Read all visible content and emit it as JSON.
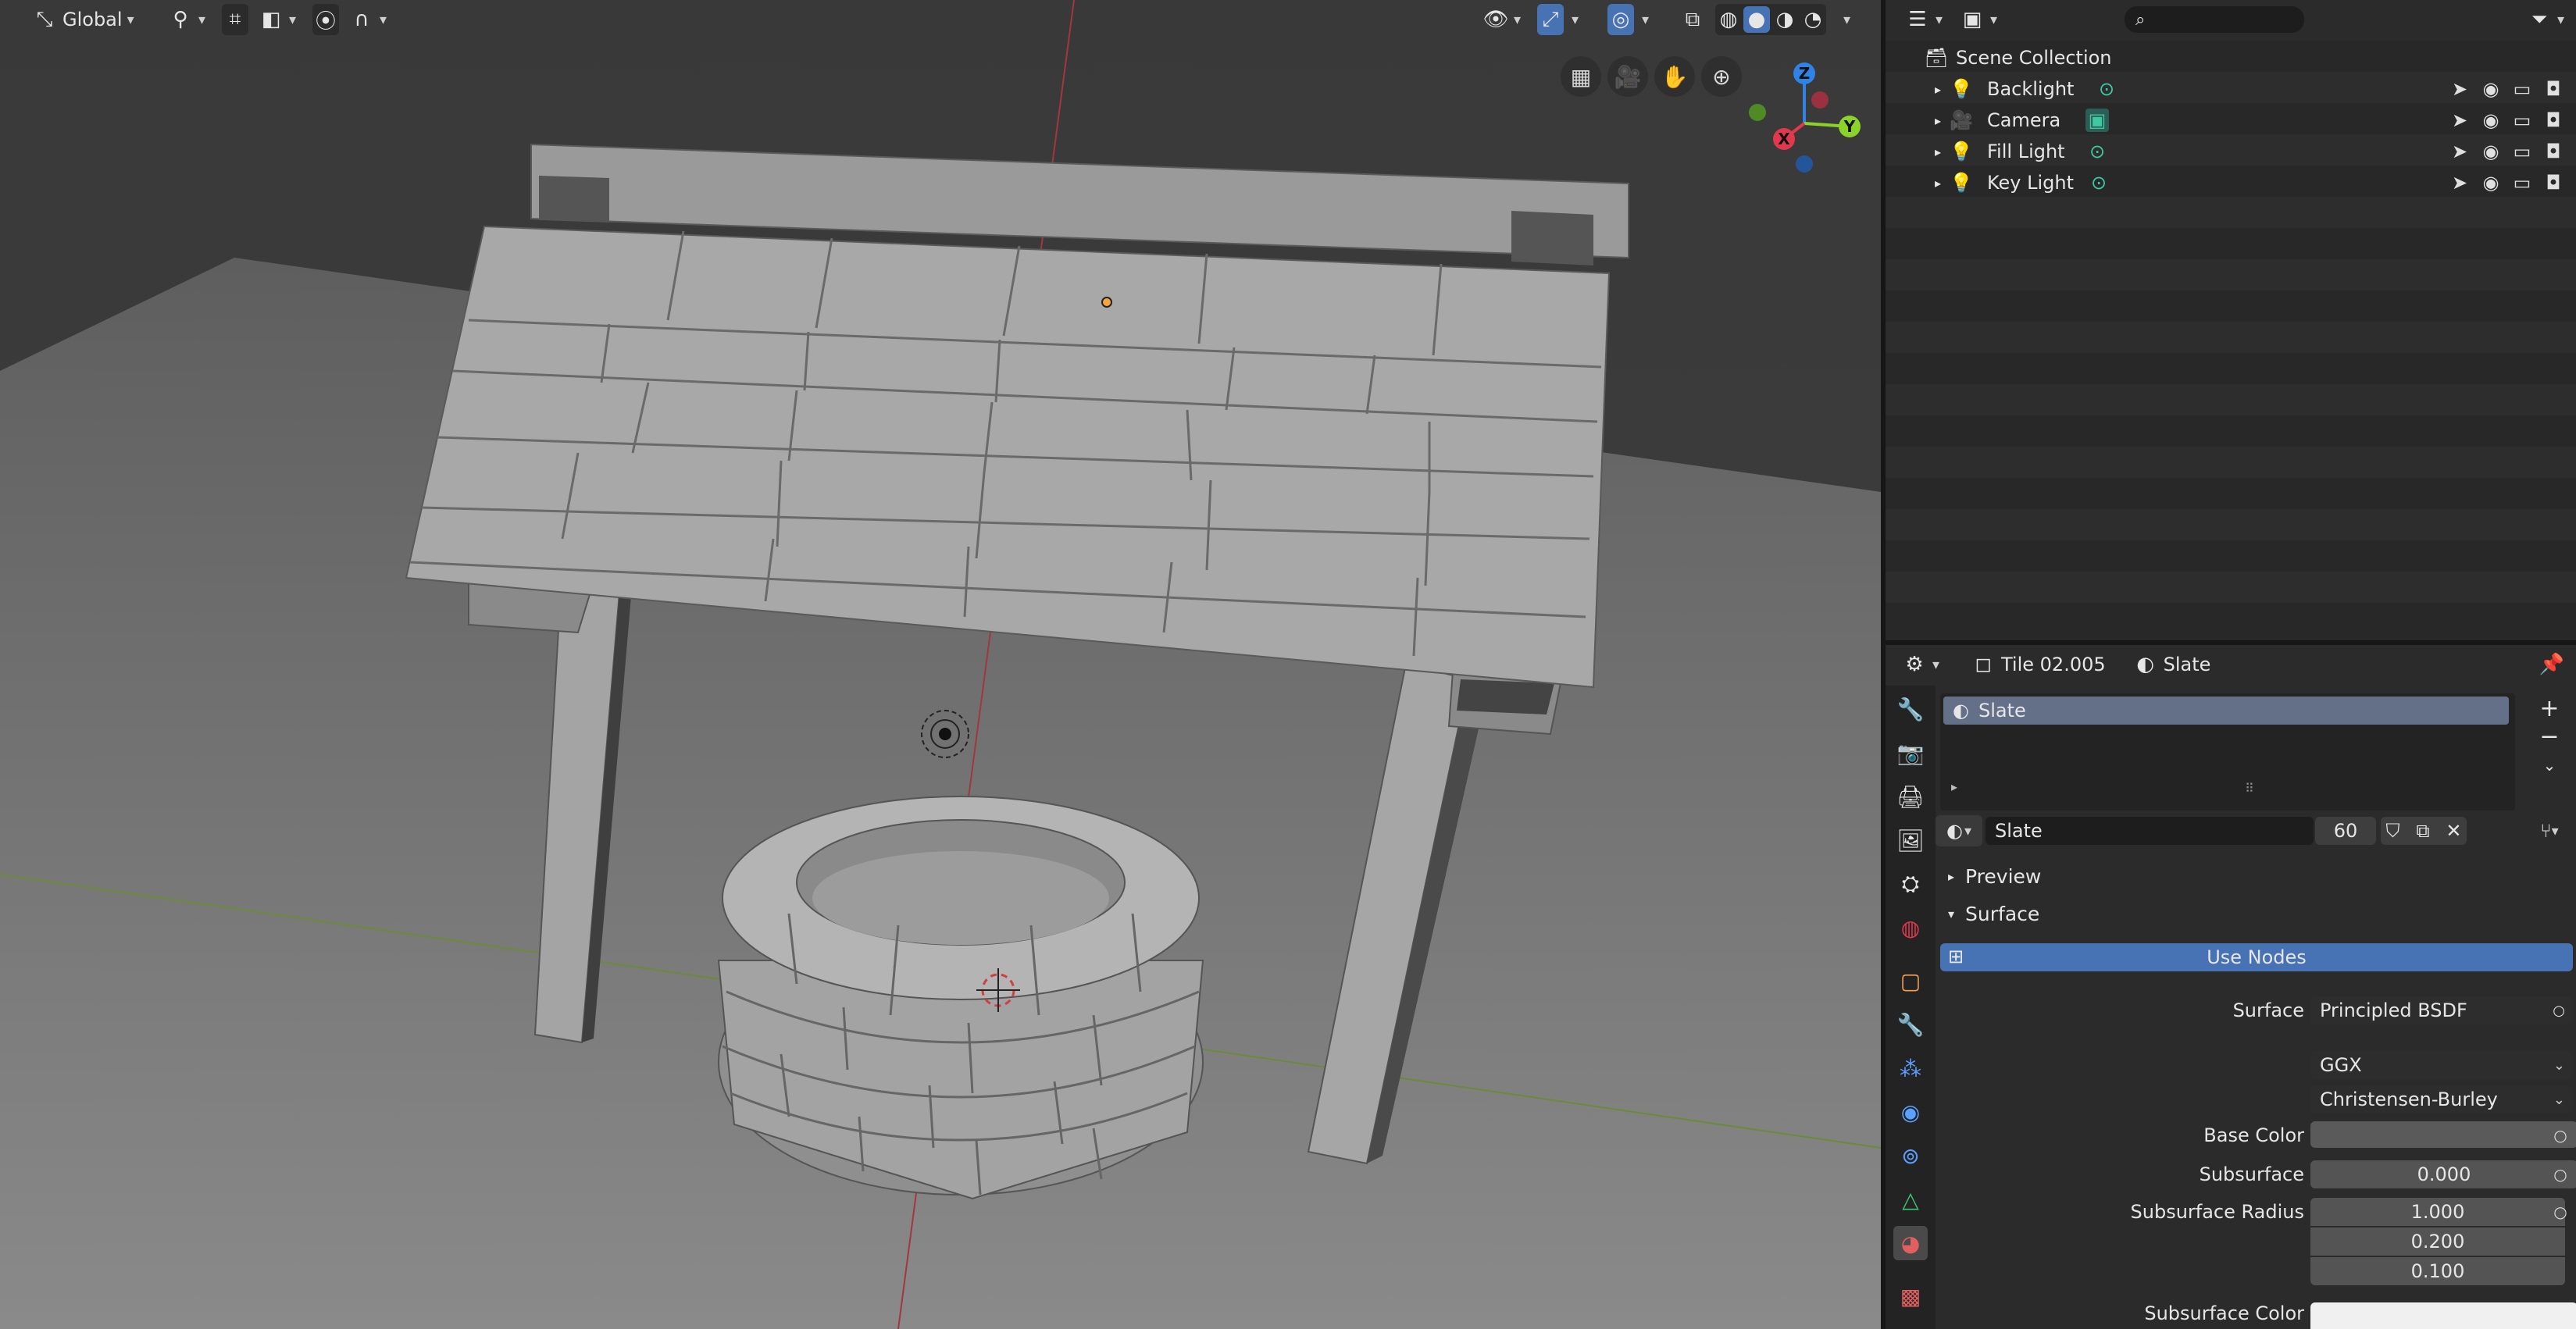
{
  "viewport": {
    "transform_orientation": "Global",
    "gizmo_axes": {
      "x": "X",
      "y": "Y",
      "z": "Z"
    }
  },
  "outliner": {
    "root": "Scene Collection",
    "items": [
      {
        "label": "Backlight"
      },
      {
        "label": "Camera"
      },
      {
        "label": "Fill Light"
      },
      {
        "label": "Key Light"
      }
    ]
  },
  "properties": {
    "object_name": "Tile 02.005",
    "material_name": "Slate",
    "slots": [
      {
        "label": "Slate"
      }
    ],
    "material_field": "Slate",
    "user_count": "60",
    "panels": {
      "preview": "Preview",
      "surface": "Surface"
    },
    "use_nodes_label": "Use Nodes",
    "fields": {
      "surface_label": "Surface",
      "surface_value": "Principled BSDF",
      "distribution": "GGX",
      "subsurface_method": "Christensen-Burley",
      "base_color_label": "Base Color",
      "subsurface_label": "Subsurface",
      "subsurface_value": "0.000",
      "subsurface_radius_label": "Subsurface Radius",
      "radius_values": [
        "1.000",
        "0.200",
        "0.100"
      ],
      "subsurface_color_label": "Subsurface Color"
    }
  },
  "colors": {
    "accent": "#4772b3",
    "viewport_bg": "#3d3d3d",
    "x_axis": "#e0394d",
    "y_axis": "#8bd32a",
    "z_axis": "#2f82e6"
  }
}
